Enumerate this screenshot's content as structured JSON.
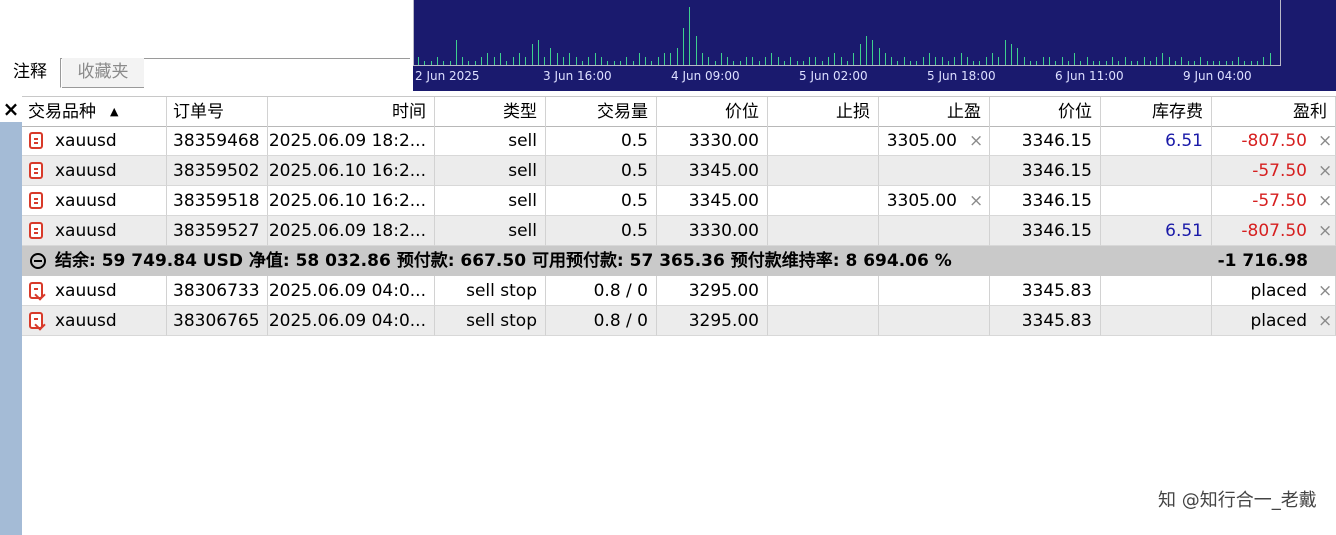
{
  "tabs": {
    "notes": "注释",
    "favorites": "收藏夹"
  },
  "chart": {
    "x_labels": [
      "2 Jun 2025",
      "3 Jun 16:00",
      "4 Jun 09:00",
      "5 Jun 02:00",
      "5 Jun 18:00",
      "6 Jun 11:00",
      "9 Jun 04:00"
    ],
    "bar_color": "#3ecf8e",
    "background": "#1a1a6e",
    "volumes": [
      2,
      1,
      1,
      2,
      1,
      1,
      6,
      2,
      1,
      1,
      2,
      3,
      2,
      3,
      1,
      2,
      3,
      2,
      5,
      6,
      2,
      4,
      3,
      2,
      3,
      2,
      1,
      2,
      3,
      2,
      1,
      1,
      1,
      2,
      1,
      3,
      2,
      1,
      2,
      3,
      3,
      4,
      9,
      14,
      7,
      3,
      2,
      1,
      3,
      2,
      1,
      1,
      2,
      2,
      1,
      2,
      3,
      2,
      1,
      2,
      1,
      1,
      2,
      2,
      1,
      2,
      3,
      2,
      1,
      3,
      5,
      7,
      6,
      4,
      3,
      2,
      1,
      2,
      1,
      1,
      2,
      3,
      2,
      2,
      1,
      2,
      3,
      2,
      1,
      1,
      2,
      3,
      2,
      6,
      5,
      4,
      2,
      1,
      1,
      2,
      2,
      1,
      2,
      1,
      3,
      1,
      2,
      1,
      1,
      1,
      2,
      1,
      2,
      1,
      1,
      2,
      1,
      2,
      3,
      2,
      1,
      2,
      1,
      1,
      2,
      1,
      1,
      1,
      1,
      1,
      2,
      1,
      1,
      1,
      2,
      3
    ]
  },
  "sidebar": {
    "close": "×"
  },
  "columns": [
    "交易品种",
    "订单号",
    "时间",
    "类型",
    "交易量",
    "价位",
    "止损",
    "止盈",
    "价位",
    "库存费",
    "盈利"
  ],
  "positions": [
    {
      "symbol": "xauusd",
      "order": "38359468",
      "time": "2025.06.09 18:2...",
      "type": "sell",
      "volume": "0.5",
      "price": "3330.00",
      "sl": "",
      "tp": "3305.00",
      "current": "3346.15",
      "swap": "6.51",
      "profit": "-807.50"
    },
    {
      "symbol": "xauusd",
      "order": "38359502",
      "time": "2025.06.10 16:2...",
      "type": "sell",
      "volume": "0.5",
      "price": "3345.00",
      "sl": "",
      "tp": "",
      "current": "3346.15",
      "swap": "",
      "profit": "-57.50"
    },
    {
      "symbol": "xauusd",
      "order": "38359518",
      "time": "2025.06.10 16:2...",
      "type": "sell",
      "volume": "0.5",
      "price": "3345.00",
      "sl": "",
      "tp": "3305.00",
      "current": "3346.15",
      "swap": "",
      "profit": "-57.50"
    },
    {
      "symbol": "xauusd",
      "order": "38359527",
      "time": "2025.06.09 18:2...",
      "type": "sell",
      "volume": "0.5",
      "price": "3330.00",
      "sl": "",
      "tp": "",
      "current": "3346.15",
      "swap": "6.51",
      "profit": "-807.50"
    }
  ],
  "summary": {
    "text": "结余: 59 749.84 USD  净值: 58 032.86  预付款: 667.50  可用预付款: 57 365.36  预付款维持率: 8 694.06 %",
    "total": "-1 716.98"
  },
  "orders": [
    {
      "symbol": "xauusd",
      "order": "38306733",
      "time": "2025.06.09 04:0...",
      "type": "sell stop",
      "volume": "0.8 / 0",
      "price": "3295.00",
      "sl": "",
      "tp": "",
      "current": "3345.83",
      "status": "placed"
    },
    {
      "symbol": "xauusd",
      "order": "38306765",
      "time": "2025.06.09 04:0...",
      "type": "sell stop",
      "volume": "0.8 / 0",
      "price": "3295.00",
      "sl": "",
      "tp": "",
      "current": "3345.83",
      "status": "placed"
    }
  ],
  "watermark": "知 @知行合一_老戴",
  "colors": {
    "profit_negative": "#d61f1f",
    "swap": "#1a1aa8",
    "sidebar": "#a4bbd6",
    "summary_bg": "#c9c9c9"
  }
}
